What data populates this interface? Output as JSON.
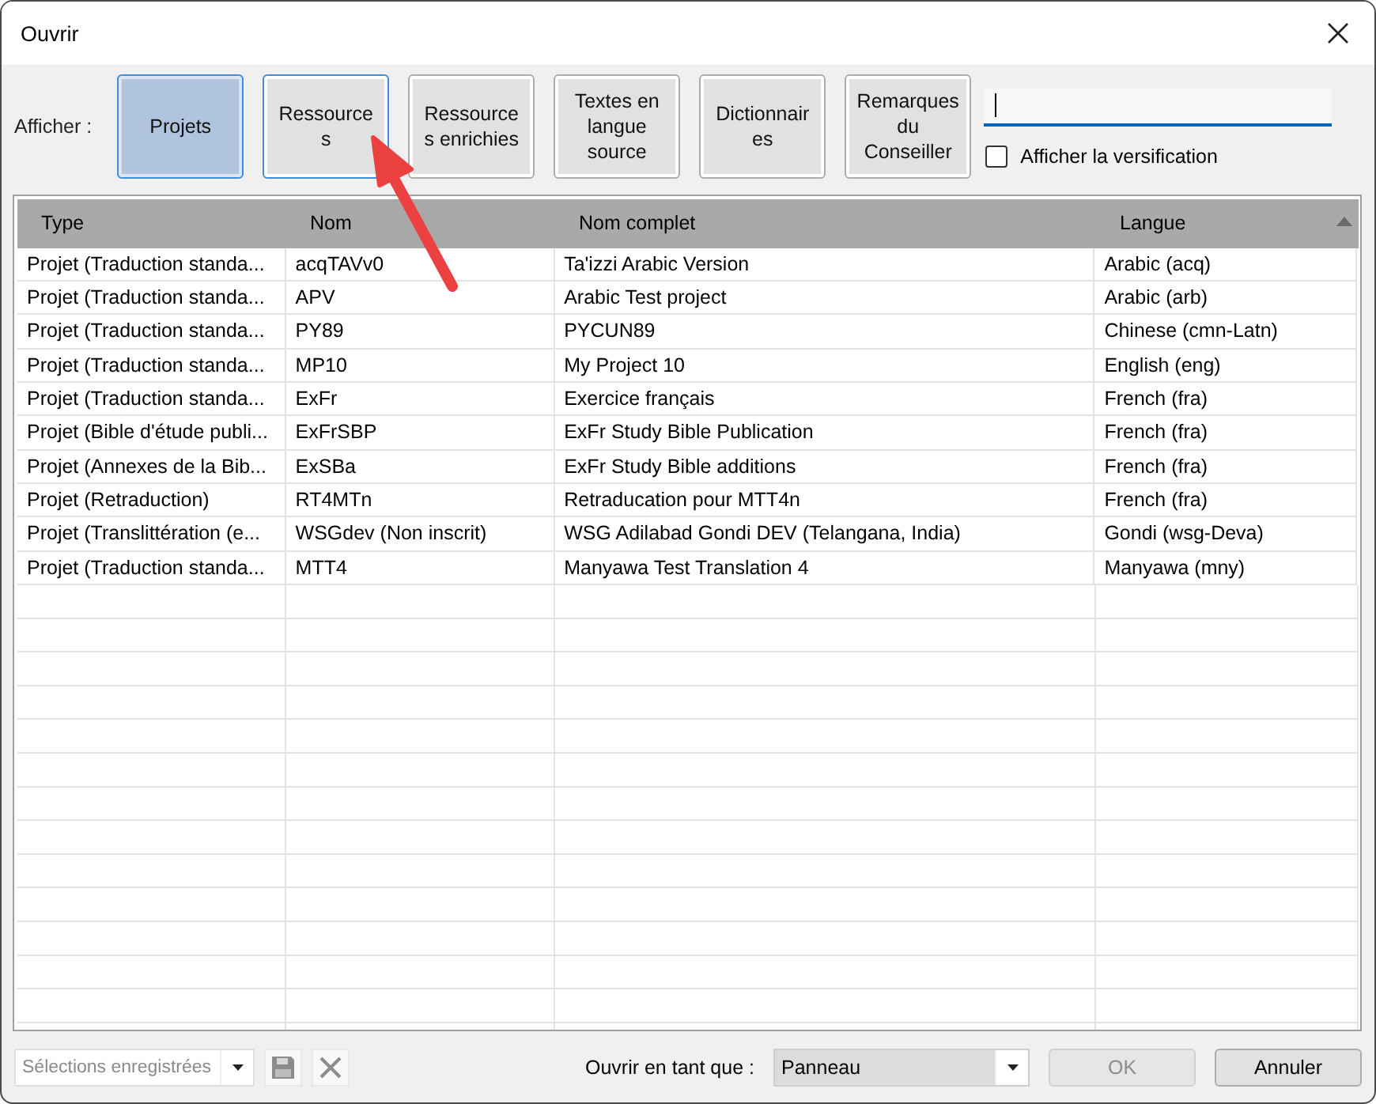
{
  "window": {
    "title": "Ouvrir"
  },
  "filter": {
    "label": "Afficher :",
    "buttons": [
      {
        "lines": [
          "Projets"
        ],
        "selected": true,
        "focused": false
      },
      {
        "lines": [
          "Ressource",
          "s"
        ],
        "selected": false,
        "focused": true
      },
      {
        "lines": [
          "Ressource",
          "s enrichies"
        ],
        "selected": false,
        "focused": false
      },
      {
        "lines": [
          "Textes en",
          "langue",
          "source"
        ],
        "selected": false,
        "focused": false
      },
      {
        "lines": [
          "Dictionnair",
          "es"
        ],
        "selected": false,
        "focused": false
      },
      {
        "lines": [
          "Remarques",
          "du",
          "Conseiller"
        ],
        "selected": false,
        "focused": false
      }
    ],
    "checkbox": {
      "label": "Afficher la versification",
      "checked": false
    }
  },
  "table": {
    "columns": [
      {
        "label": "Type",
        "sorted": false
      },
      {
        "label": "Nom",
        "sorted": false
      },
      {
        "label": "Nom complet",
        "sorted": false
      },
      {
        "label": "Langue",
        "sorted": true
      }
    ],
    "rows": [
      [
        "Projet (Traduction standa...",
        "acqTAVv0",
        "Ta'izzi Arabic Version",
        "Arabic (acq)"
      ],
      [
        "Projet (Traduction standa...",
        "APV",
        "Arabic Test project",
        "Arabic (arb)"
      ],
      [
        "Projet (Traduction standa...",
        "PY89",
        "PYCUN89",
        "Chinese (cmn-Latn)"
      ],
      [
        "Projet (Traduction standa...",
        "MP10",
        "My Project 10",
        "English (eng)"
      ],
      [
        "Projet (Traduction standa...",
        "ExFr",
        "Exercice français",
        "French (fra)"
      ],
      [
        "Projet (Bible d'étude publi...",
        "ExFrSBP",
        "ExFr Study Bible Publication",
        "French (fra)"
      ],
      [
        "Projet (Annexes de la Bib...",
        "ExSBa",
        "ExFr Study Bible additions",
        "French (fra)"
      ],
      [
        "Projet (Retraduction)",
        "RT4MTn",
        "Retraducation pour MTT4n",
        "French (fra)"
      ],
      [
        "Projet (Translittération (e...",
        "WSGdev (Non inscrit)",
        "WSG Adilabad Gondi DEV (Telangana, India)",
        "Gondi (wsg-Deva)"
      ],
      [
        "Projet (Traduction standa...",
        "MTT4",
        "Manyawa Test Translation 4",
        "Manyawa (mny)"
      ]
    ]
  },
  "footer": {
    "saved_selections": {
      "value": "Sélections enregistrées",
      "disabled": true
    },
    "open_as": {
      "label": "Ouvrir en tant que :",
      "value": "Panneau"
    },
    "buttons": [
      {
        "label": "OK",
        "disabled": true
      },
      {
        "label": "Annuler",
        "disabled": false
      }
    ]
  }
}
